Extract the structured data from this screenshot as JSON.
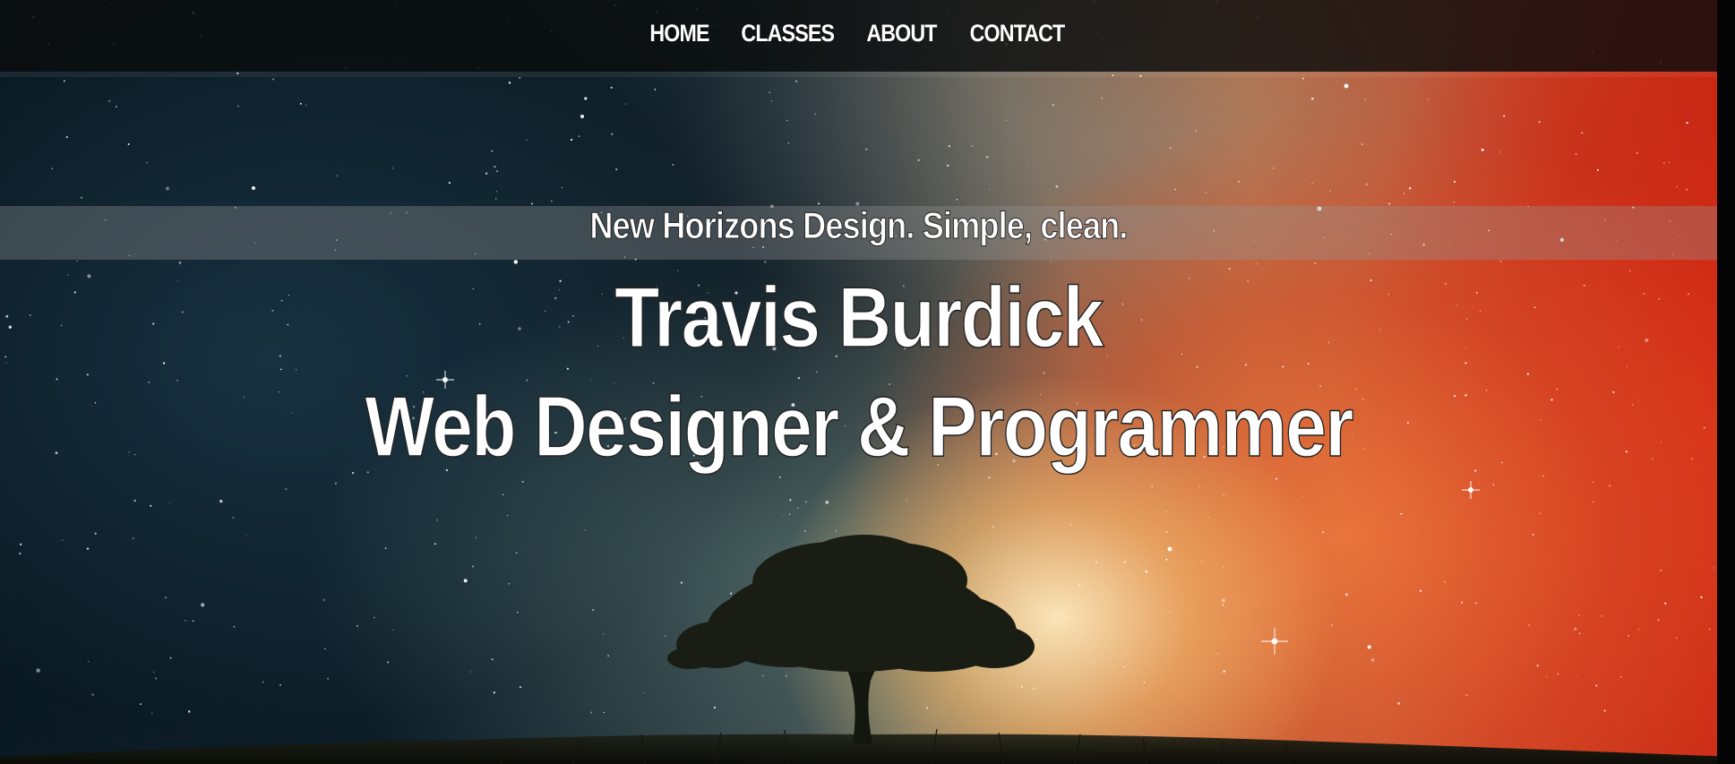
{
  "nav": {
    "items": [
      {
        "label": "HOME"
      },
      {
        "label": "CLASSES"
      },
      {
        "label": "ABOUT"
      },
      {
        "label": "CONTACT"
      }
    ]
  },
  "hero": {
    "tagline": "New Horizons Design. Simple, clean.",
    "name": "Travis Burdick",
    "role": "Web Designer & Programmer"
  },
  "colors": {
    "text": "#ffffff",
    "nav_background": "#0a0c0e",
    "sky_left": "#0b1a24",
    "glow_center": "#ffecbe",
    "sky_right": "#c82512"
  }
}
